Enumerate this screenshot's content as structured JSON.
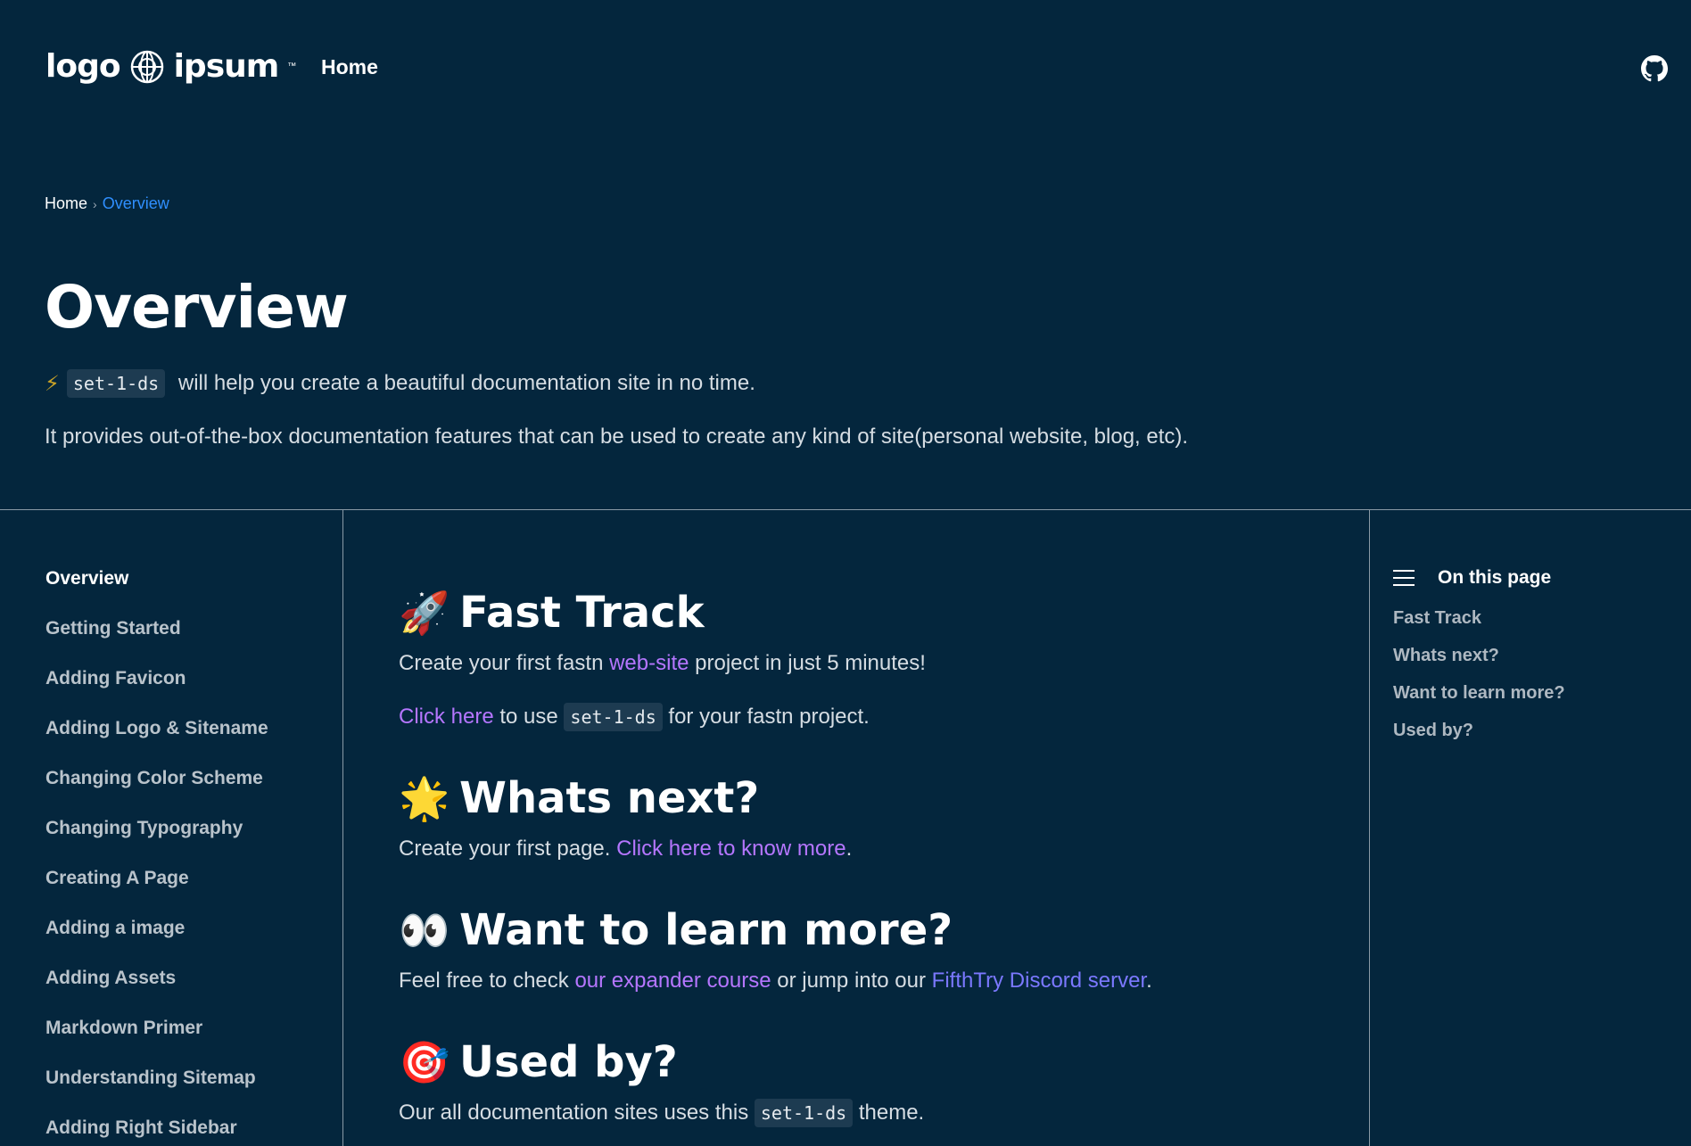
{
  "header": {
    "logo_text_left": "logo",
    "logo_text_right": "ipsum",
    "logo_tm": "™",
    "nav_home": "Home",
    "github_icon": "github-icon"
  },
  "breadcrumb": {
    "home": "Home",
    "separator": "›",
    "current": "Overview"
  },
  "hero": {
    "title": "Overview",
    "intro_emoji": "⚡",
    "intro_code": "set-1-ds",
    "intro_text": " will help you create a beautiful documentation site in no time.",
    "intro_2": "It provides out-of-the-box documentation features that can be used to create any kind of site(personal website, blog, etc)."
  },
  "sidebar": {
    "items": [
      {
        "label": "Overview",
        "active": true
      },
      {
        "label": "Getting Started"
      },
      {
        "label": "Adding Favicon"
      },
      {
        "label": "Adding Logo & Sitename"
      },
      {
        "label": "Changing Color Scheme"
      },
      {
        "label": "Changing Typography"
      },
      {
        "label": "Creating A Page"
      },
      {
        "label": "Adding a image"
      },
      {
        "label": "Adding Assets"
      },
      {
        "label": "Markdown Primer"
      },
      {
        "label": "Understanding Sitemap"
      },
      {
        "label": "Adding Right Sidebar"
      }
    ]
  },
  "main": {
    "fast_track": {
      "emoji": "🚀",
      "title": "Fast Track",
      "p1_a": "Create your first fastn ",
      "p1_link": "web-site",
      "p1_b": " project in just 5 minutes!",
      "p2_link": "Click here",
      "p2_a": " to use ",
      "p2_code": "set-1-ds",
      "p2_b": " for your fastn project."
    },
    "whats_next": {
      "emoji": "🌟",
      "title": "Whats next?",
      "p_a": "Create your first page. ",
      "p_link": "Click here to know more",
      "p_b": "."
    },
    "learn_more": {
      "emoji": "👀",
      "title": "Want to learn more?",
      "p_a": "Feel free to check ",
      "p_link1": "our expander course",
      "p_b": " or jump into our ",
      "p_link2": "FifthTry Discord server",
      "p_c": "."
    },
    "used_by": {
      "emoji": "🎯",
      "title": "Used by?",
      "p_a": "Our all documentation sites uses this ",
      "p_code": "set-1-ds",
      "p_b": " theme."
    }
  },
  "toc": {
    "heading": "On this page",
    "items": [
      "Fast Track",
      "Whats next?",
      "Want to learn more?",
      "Used by?"
    ]
  },
  "colors": {
    "background": "#04263d",
    "link_purple": "#b576ff",
    "link_blue": "#7b78ff",
    "breadcrumb_active": "#2f8fff"
  }
}
